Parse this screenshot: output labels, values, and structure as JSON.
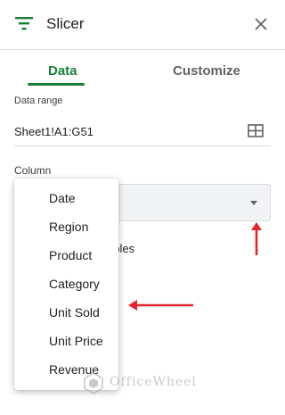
{
  "header": {
    "title": "Slicer",
    "slicer_icon": "filter-icon",
    "close_icon": "close-icon"
  },
  "tabs": [
    {
      "label": "Data",
      "active": true
    },
    {
      "label": "Customize",
      "active": false
    }
  ],
  "data_range": {
    "label": "Data range",
    "value": "Sheet1!A1:G51",
    "grid_icon": "select-range-icon"
  },
  "column": {
    "label": "Column",
    "value": "",
    "obscured_text": "ables"
  },
  "dropdown": {
    "options": [
      "Date",
      "Region",
      "Product",
      "Category",
      "Unit Sold",
      "Unit Price",
      "Revenue"
    ]
  },
  "annotations": {
    "arrow_color": "#e3242b"
  },
  "watermark": {
    "text": "OfficeWheel"
  },
  "colors": {
    "accent": "#188038",
    "muted": "#5f6368"
  }
}
